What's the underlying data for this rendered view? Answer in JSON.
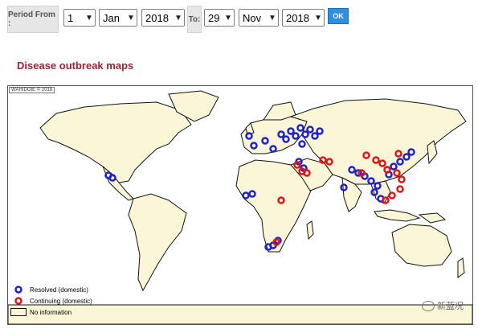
{
  "filter": {
    "period_from_label": "Period From :",
    "to_label": "To:",
    "from_day": "1",
    "from_month": "Jan",
    "from_year": "2018",
    "to_day": "29",
    "to_month": "Nov",
    "to_year": "2018",
    "ok_label": "OK"
  },
  "page": {
    "title": "Disease outbreak maps"
  },
  "map": {
    "copyright": "WAHIDOIE © 2018",
    "colors": {
      "ocean": "#ffffff",
      "land": "#fbf6d8",
      "resolved": "#1f22c8",
      "continuing": "#e0151a"
    },
    "legend": {
      "resolved": "Resolved (domestic)",
      "continuing": "Continuing (domestic)",
      "no_information": "No information"
    }
  },
  "watermark": {
    "text": "新蓝况"
  }
}
